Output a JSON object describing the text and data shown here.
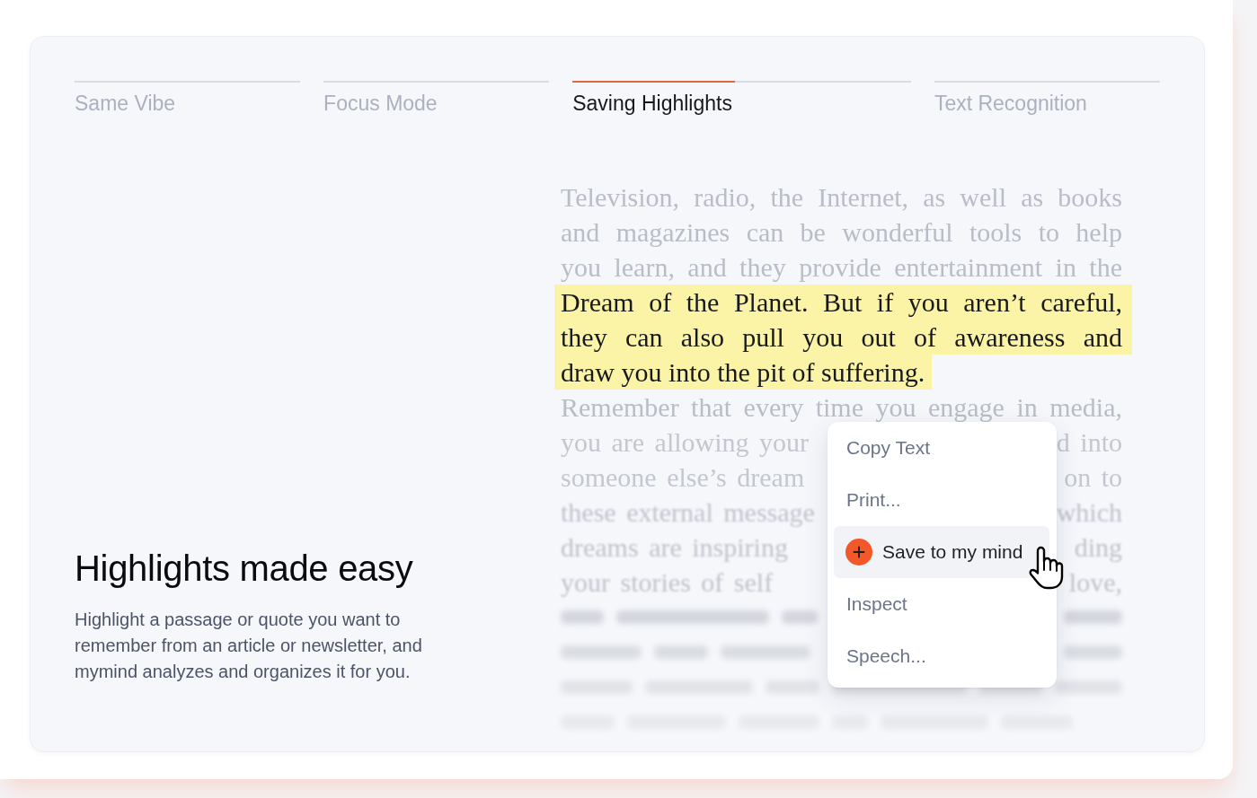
{
  "tabs": [
    {
      "label": "Same Vibe",
      "selected": false
    },
    {
      "label": "Focus Mode",
      "selected": false
    },
    {
      "label": "Saving Highlights",
      "selected": true
    },
    {
      "label": "Text Recognition",
      "selected": false
    }
  ],
  "tab_progress": {
    "level": 0.48
  },
  "feature": {
    "title": "Highlights made easy",
    "description": "Highlight a passage or quote you want to remember from an article or newsletter, and mymind analyzes and organizes it for you."
  },
  "article": {
    "lines": [
      {
        "text": "Television, radio, the Internet, as well as books",
        "highlighted": false,
        "paragraph_end": false
      },
      {
        "text": "and magazines can be wonderful tools to help",
        "highlighted": false,
        "paragraph_end": false
      },
      {
        "text": "you learn, and they provide entertainment in the",
        "highlighted": false,
        "paragraph_end": false
      },
      {
        "text": "Dream of the Planet. But if you aren’t careful,",
        "highlighted": true,
        "paragraph_end": false
      },
      {
        "text": "they can also pull you out of awareness and",
        "highlighted": true,
        "paragraph_end": false
      },
      {
        "text": "draw you into the pit of suffering.",
        "highlighted": true,
        "paragraph_end": true
      },
      {
        "text": "Remember that every time you engage in media,",
        "highlighted": false,
        "paragraph_end": false
      }
    ],
    "covered_lines": [
      {
        "left": "you are allowing your",
        "right": "d into",
        "kind": "faded"
      },
      {
        "left": "someone else’s dream",
        "right": "on to",
        "kind": "faded"
      },
      {
        "left": "these external message",
        "right": "which",
        "kind": "blurred"
      },
      {
        "left": "dreams are inspiring",
        "right": "ding",
        "kind": "blurred"
      },
      {
        "left": "your stories of self",
        "right": "love,",
        "kind": "blurred"
      }
    ]
  },
  "context_menu": {
    "items": [
      {
        "label": "Copy Text",
        "kind": "plain",
        "selected": false
      },
      {
        "label": "Print...",
        "kind": "plain",
        "selected": false
      },
      {
        "label": "Save to my mind",
        "kind": "action",
        "selected": true
      },
      {
        "label": "Inspect",
        "kind": "plain",
        "selected": false
      },
      {
        "label": "Speech...",
        "kind": "plain",
        "selected": false
      }
    ]
  }
}
